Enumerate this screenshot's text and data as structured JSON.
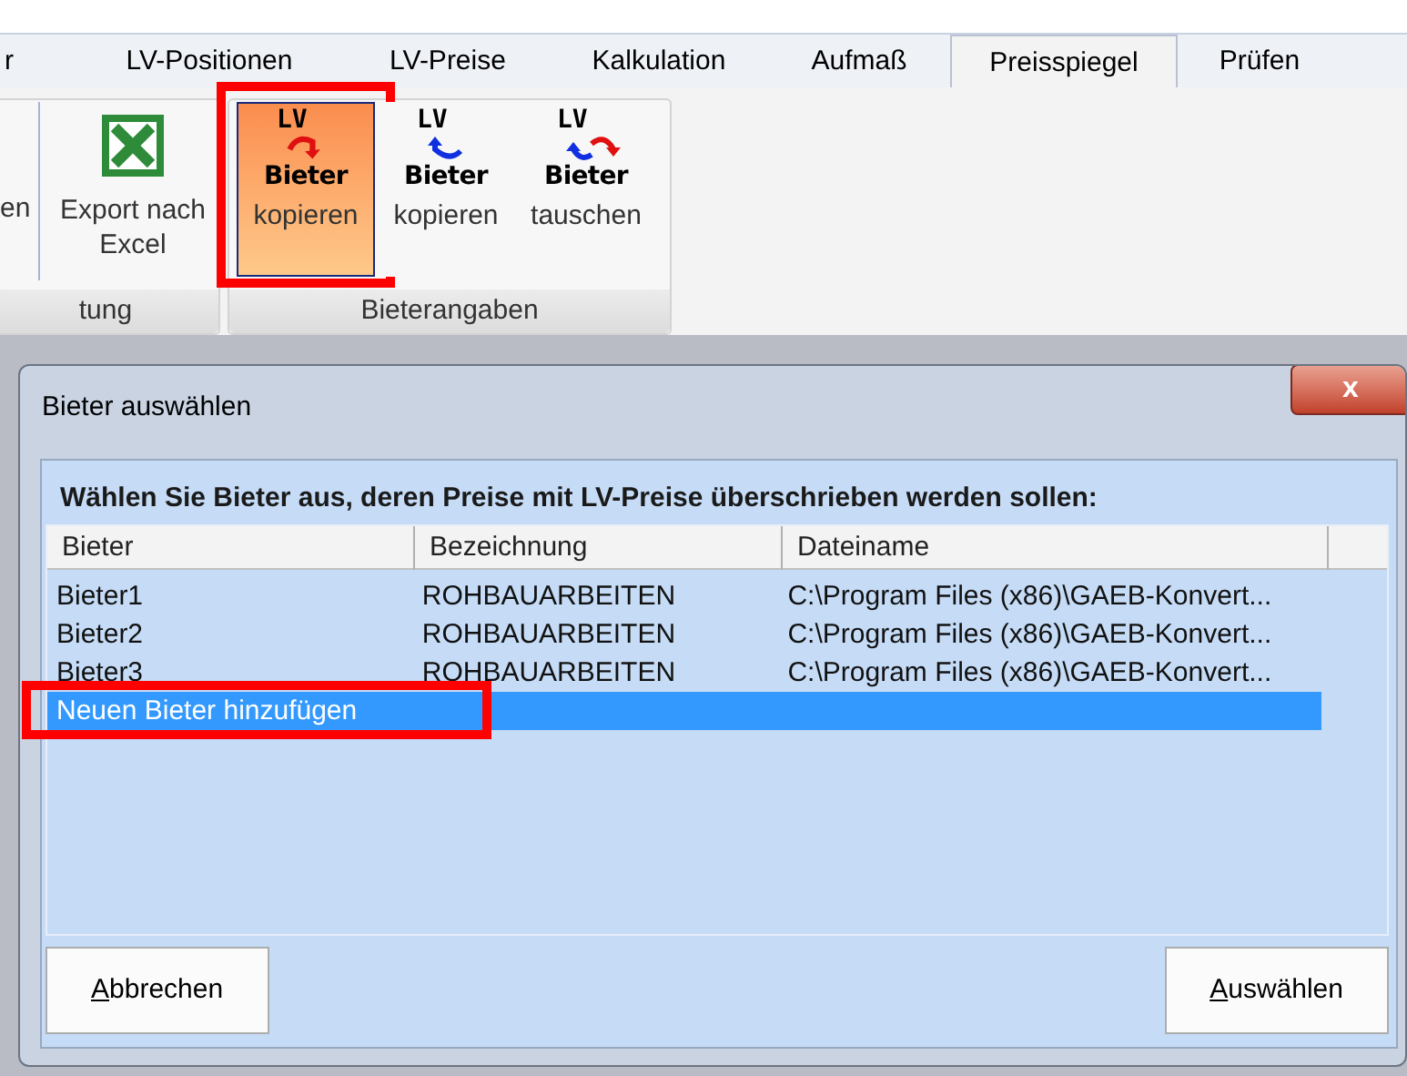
{
  "tabs": [
    {
      "label": "r",
      "selected": false
    },
    {
      "label": "LV-Positionen",
      "selected": false
    },
    {
      "label": "LV-Preise",
      "selected": false
    },
    {
      "label": "Kalkulation",
      "selected": false
    },
    {
      "label": "Aufmaß",
      "selected": false
    },
    {
      "label": "Preisspiegel",
      "selected": true
    },
    {
      "label": "Prüfen",
      "selected": false
    }
  ],
  "ribbon": {
    "groups": [
      {
        "label": "tung",
        "buttons": [
          {
            "kind": "partial",
            "label": "en"
          },
          {
            "kind": "excel",
            "label": "Export nach Excel"
          }
        ]
      },
      {
        "label": "Bieterangaben",
        "buttons": [
          {
            "kind": "copy-red",
            "icon_top": "LV",
            "icon_bottom": "Bieter",
            "label": "kopieren",
            "selected": true,
            "highlighted": true
          },
          {
            "kind": "copy-blue",
            "icon_top": "LV",
            "icon_bottom": "Bieter",
            "label": "kopieren",
            "selected": false,
            "highlighted": false
          },
          {
            "kind": "swap",
            "icon_top": "LV",
            "icon_bottom": "Bieter",
            "label": "tauschen",
            "selected": false,
            "highlighted": false
          }
        ]
      }
    ]
  },
  "dialog": {
    "title": "Bieter auswählen",
    "close": "x",
    "prompt": "Wählen Sie Bieter aus, deren Preise mit LV-Preise überschrieben werden sollen:",
    "table": {
      "columns": [
        "Bieter",
        "Bezeichnung",
        "Dateiname"
      ],
      "rows": [
        {
          "cells": [
            "Bieter1",
            "ROHBAUARBEITEN",
            "C:\\Program Files (x86)\\GAEB-Konvert..."
          ],
          "selected": false,
          "highlighted": false
        },
        {
          "cells": [
            "Bieter2",
            "ROHBAUARBEITEN",
            "C:\\Program Files (x86)\\GAEB-Konvert..."
          ],
          "selected": false,
          "highlighted": false
        },
        {
          "cells": [
            "Bieter3",
            "ROHBAUARBEITEN",
            "C:\\Program Files (x86)\\GAEB-Konvert..."
          ],
          "selected": false,
          "highlighted": false
        },
        {
          "cells": [
            "Neuen Bieter hinzufügen"
          ],
          "selected": true,
          "highlighted": true
        }
      ]
    },
    "buttons": [
      {
        "label": "Abbrechen",
        "underline_first": true
      },
      {
        "label": "Auswählen",
        "underline_first": true
      }
    ]
  }
}
